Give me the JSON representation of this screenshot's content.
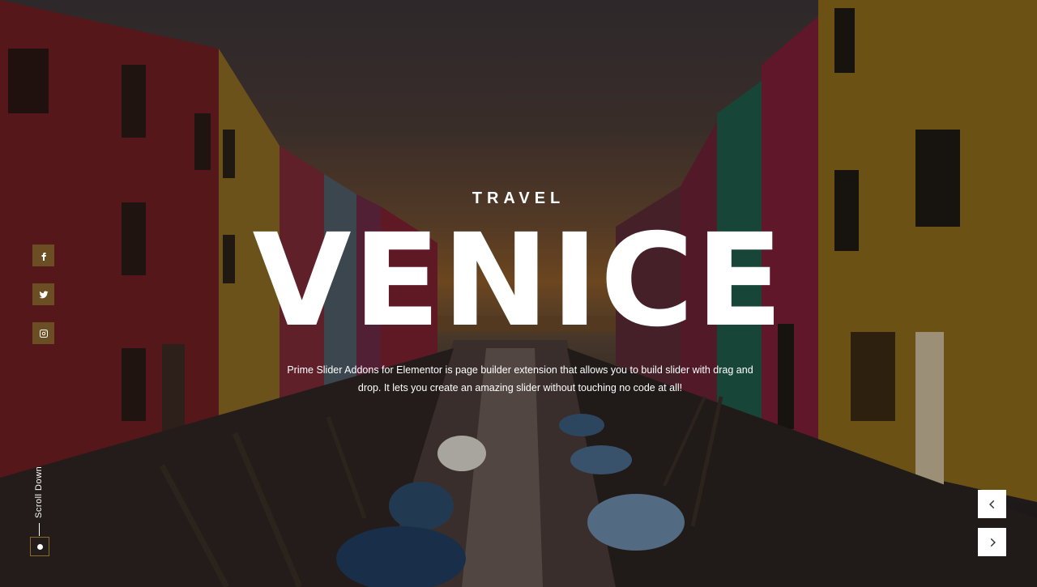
{
  "hero": {
    "subtitle": "TRAVEL",
    "title": "VENICE",
    "description": "Prime Slider Addons for Elementor is page builder extension that allows you to build slider with drag and drop. It lets you create an amazing slider without touching no code at all!"
  },
  "social": {
    "items": [
      {
        "icon": "facebook-icon"
      },
      {
        "icon": "twitter-icon"
      },
      {
        "icon": "instagram-icon"
      }
    ],
    "button_color": "#6b4e23"
  },
  "scroll": {
    "label": "Scroll Down",
    "box_color": "#8a6a2a"
  },
  "navigation": {
    "prev_icon": "chevron-left-icon",
    "next_icon": "chevron-right-icon"
  }
}
